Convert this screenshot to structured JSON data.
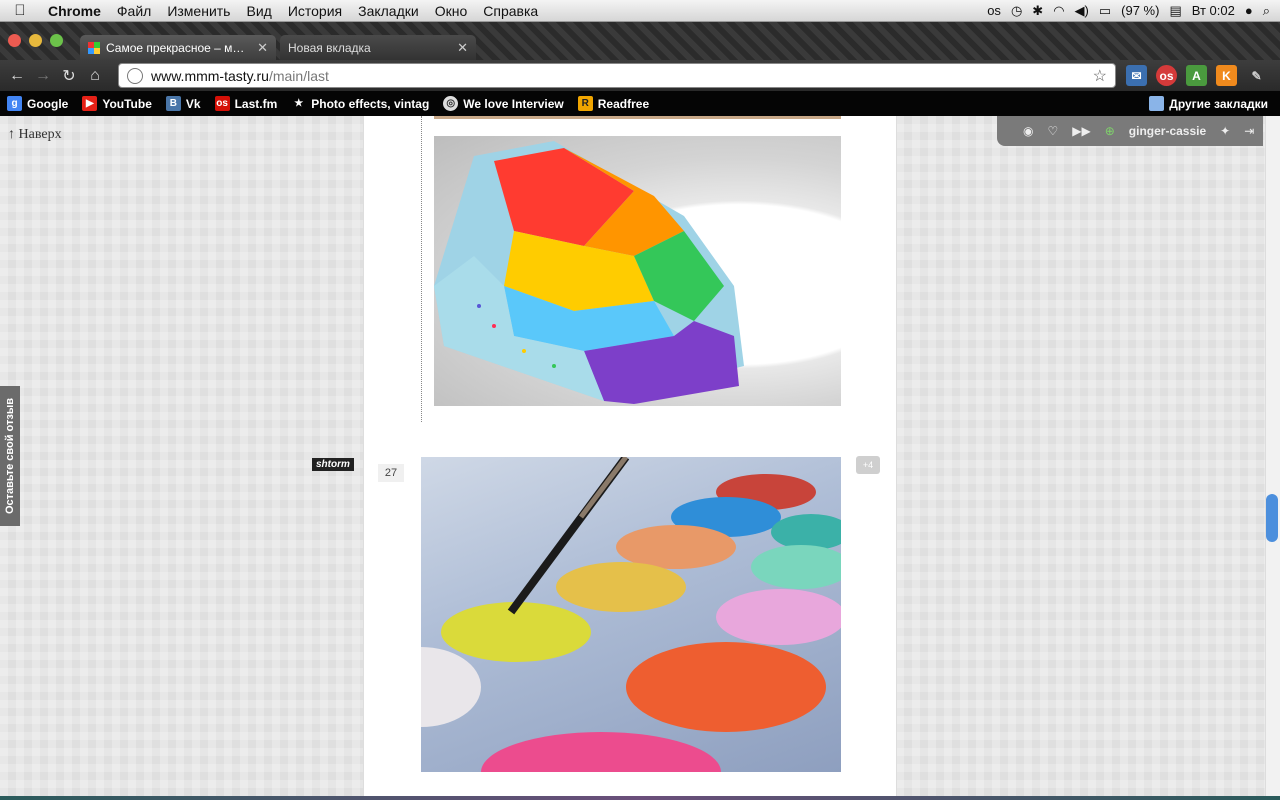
{
  "menubar": {
    "app_name": "Chrome",
    "items": [
      "Файл",
      "Изменить",
      "Вид",
      "История",
      "Закладки",
      "Окно",
      "Справка"
    ],
    "battery": "(97 %)",
    "clock": "Вт 0:02"
  },
  "tabs": [
    {
      "label": "Самое прекрасное – ммм...",
      "active": true
    },
    {
      "label": "Новая вкладка",
      "active": false
    }
  ],
  "omnibox": {
    "host": "www.mmm-tasty.ru",
    "path": "/main/last"
  },
  "bookmarks": {
    "items": [
      {
        "label": "Google",
        "icon": "google-icon",
        "color": "#4285f4"
      },
      {
        "label": "YouTube",
        "icon": "youtube-icon",
        "color": "#e62117"
      },
      {
        "label": "Vk",
        "icon": "vk-icon",
        "color": "#4a76a8"
      },
      {
        "label": "Last.fm",
        "icon": "lastfm-icon",
        "color": "#d51007"
      },
      {
        "label": "Photo effects, vintag",
        "icon": "star-icon",
        "color": "#ffffff"
      },
      {
        "label": "We love Interview",
        "icon": "globe-icon",
        "color": "#dddddd"
      },
      {
        "label": "Readfree",
        "icon": "readfree-icon",
        "color": "#f0a500"
      }
    ],
    "other": "Другие закладки"
  },
  "page": {
    "to_top": "↑ Наверх",
    "feedback": "Оставьте свой отзыв",
    "author": "shtorm",
    "post_number": "27",
    "comments": "+4",
    "floatbar_user": "ginger-cassie"
  }
}
